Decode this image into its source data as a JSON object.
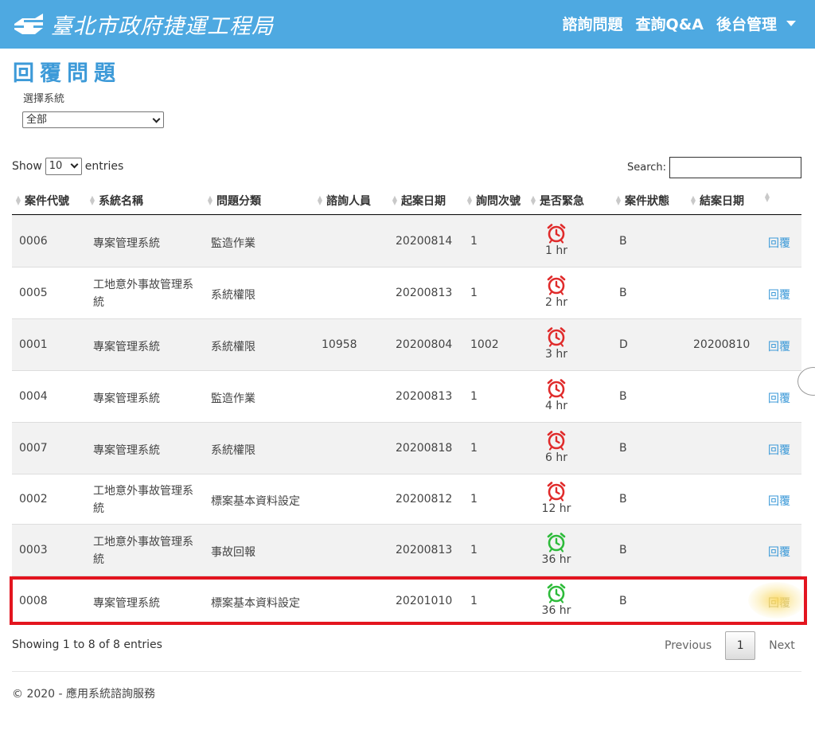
{
  "header": {
    "brand": "臺北市政府捷運工程局",
    "nav": [
      "諮詢問題",
      "查詢Q&A",
      "後台管理"
    ]
  },
  "page": {
    "title": "回覆問題",
    "system_label": "選擇系統",
    "system_selected": "全部"
  },
  "table_controls": {
    "show": "Show",
    "length_value": "10",
    "entries": "entries",
    "search_label": "Search:",
    "search_value": ""
  },
  "table": {
    "columns": [
      "案件代號",
      "系統名稱",
      "問題分類",
      "諮詢人員",
      "起案日期",
      "詢問次號",
      "是否緊急",
      "案件狀態",
      "結案日期",
      ""
    ],
    "rows": [
      {
        "id": "0006",
        "system": "專案管理系統",
        "category": "監造作業",
        "consultant": "",
        "start_date": "20200814",
        "seq": "1",
        "urgency": "1 hr",
        "urgency_color": "red",
        "status": "B",
        "close_date": "",
        "action": "回覆"
      },
      {
        "id": "0005",
        "system": "工地意外事故管理系統",
        "category": "系統權限",
        "consultant": "",
        "start_date": "20200813",
        "seq": "1",
        "urgency": "2 hr",
        "urgency_color": "red",
        "status": "B",
        "close_date": "",
        "action": "回覆"
      },
      {
        "id": "0001",
        "system": "專案管理系統",
        "category": "系統權限",
        "consultant": "10958",
        "start_date": "20200804",
        "seq": "1002",
        "urgency": "3 hr",
        "urgency_color": "red",
        "status": "D",
        "close_date": "20200810",
        "action": "回覆"
      },
      {
        "id": "0004",
        "system": "專案管理系統",
        "category": "監造作業",
        "consultant": "",
        "start_date": "20200813",
        "seq": "1",
        "urgency": "4 hr",
        "urgency_color": "red",
        "status": "B",
        "close_date": "",
        "action": "回覆"
      },
      {
        "id": "0007",
        "system": "專案管理系統",
        "category": "系統權限",
        "consultant": "",
        "start_date": "20200818",
        "seq": "1",
        "urgency": "6 hr",
        "urgency_color": "red",
        "status": "B",
        "close_date": "",
        "action": "回覆"
      },
      {
        "id": "0002",
        "system": "工地意外事故管理系統",
        "category": "標案基本資料設定",
        "consultant": "",
        "start_date": "20200812",
        "seq": "1",
        "urgency": "12 hr",
        "urgency_color": "red",
        "status": "B",
        "close_date": "",
        "action": "回覆"
      },
      {
        "id": "0003",
        "system": "工地意外事故管理系統",
        "category": "事故回報",
        "consultant": "",
        "start_date": "20200813",
        "seq": "1",
        "urgency": "36 hr",
        "urgency_color": "green",
        "status": "B",
        "close_date": "",
        "action": "回覆"
      },
      {
        "id": "0008",
        "system": "專案管理系統",
        "category": "標案基本資料設定",
        "consultant": "",
        "start_date": "20201010",
        "seq": "1",
        "urgency": "36 hr",
        "urgency_color": "green",
        "status": "B",
        "close_date": "",
        "action": "回覆"
      }
    ]
  },
  "footer": {
    "info": "Showing 1 to 8 of 8 entries",
    "previous": "Previous",
    "page": "1",
    "next": "Next",
    "copyright": "© 2020 - 應用系統諮詢服務"
  },
  "colors": {
    "header_bg": "#4ea9e1",
    "title": "#3d9ad8",
    "alarm_red": "#e02b2b",
    "alarm_green": "#2dbb3a",
    "highlight_border": "#e3151f"
  }
}
